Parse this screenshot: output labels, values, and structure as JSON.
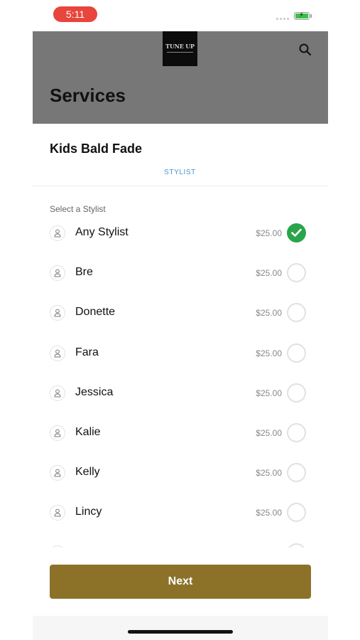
{
  "status": {
    "time": "5:11"
  },
  "header": {
    "logo_text": "TUNE UP",
    "title": "Services"
  },
  "service": {
    "name": "Kids Bald Fade",
    "tab": "STYLIST"
  },
  "stylists": {
    "label": "Select a Stylist",
    "items": [
      {
        "name": "Any Stylist",
        "price": "$25.00",
        "selected": true
      },
      {
        "name": "Bre",
        "price": "$25.00",
        "selected": false
      },
      {
        "name": "Donette",
        "price": "$25.00",
        "selected": false
      },
      {
        "name": "Fara",
        "price": "$25.00",
        "selected": false
      },
      {
        "name": "Jessica",
        "price": "$25.00",
        "selected": false
      },
      {
        "name": "Kalie",
        "price": "$25.00",
        "selected": false
      },
      {
        "name": "Kelly",
        "price": "$25.00",
        "selected": false
      },
      {
        "name": "Lincy",
        "price": "$25.00",
        "selected": false
      }
    ]
  },
  "actions": {
    "next_label": "Next"
  },
  "colors": {
    "header_bg": "#777777",
    "accent": "#8c7229",
    "tab": "#4a8fd8",
    "selected": "#2aa44a",
    "time_pill": "#e8453c"
  },
  "icons": [
    "battery-icon",
    "search-icon",
    "person-icon",
    "checkmark-icon"
  ]
}
